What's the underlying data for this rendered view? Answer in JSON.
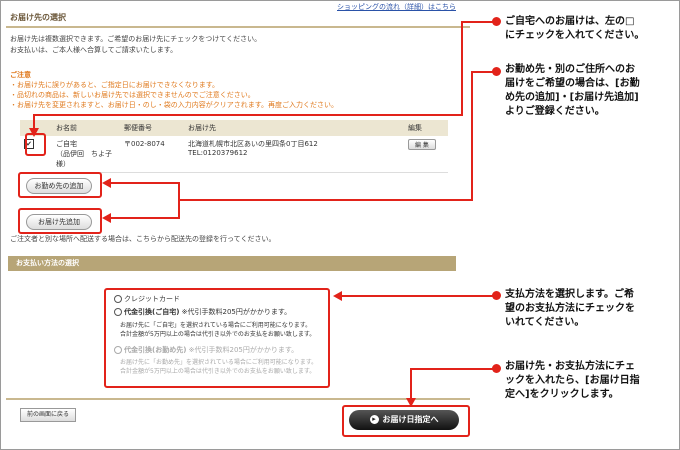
{
  "top_link": "ショッピングの流れ（詳細）はこちら",
  "header": {
    "title": "お届け先の選択"
  },
  "description": [
    "お届け先は複数選択できます。ご希望のお届け先にチェックをつけてください。",
    "お支払いは、ご本人様へ合算してご請求いたします。"
  ],
  "notice": {
    "title": "ご注意",
    "items": [
      "・お届け先に誤りがあると、ご指定日にお届けできなくなります。",
      "・品切れの商品は、新しいお届け先では選択できませんのでご注意ください。",
      "・お届け先を変更されますと、お届け日・のし・袋の入力内容がクリアされます。再度ご入力ください。"
    ]
  },
  "table": {
    "headers": [
      "お名前",
      "郵便番号",
      "お届け先",
      "編集"
    ],
    "rows": [
      {
        "checked": "✔",
        "name": "ご自宅\n（品伊回　ちよ子様）",
        "zip": "〒002-8074",
        "address": "北海道札幌市北区あいの里四条0丁目612",
        "tel": "TEL:0120379612",
        "edit": "編 集"
      }
    ]
  },
  "buttons": {
    "add_work": "お勤め先の追加",
    "add_address": "お届け先追加",
    "back": "前の画面に戻る",
    "next": "お届け日指定へ",
    "edit": "編 集"
  },
  "other_address_note": "ご注文者と別な場所へ配送する場合は、こちらから配送先の登録を行ってください。",
  "payment": {
    "section_title": "お支払い方法の選択",
    "options": [
      {
        "label": "クレジットカード",
        "note": "",
        "disabled": false
      },
      {
        "label": "代金引換(ご自宅)",
        "note": "※代引手数料205円がかかります。",
        "disabled": false
      },
      {
        "label": "代金引換(お勤め先)",
        "note": "※代引手数料205円がかかります。",
        "disabled": true
      }
    ],
    "sub_notes_home": [
      "お届け先に「ご自宅」を選択されている場合にご利用可能になります。",
      "合計金額が5万円以上の場合は代引き以外でのお支払をお願い致します。"
    ],
    "sub_notes_work": [
      "お届け先に「お勤め先」を選択されている場合にご利用可能になります。",
      "合計金額が5万円以上の場合は代引き以外でのお支払をお願い致します。"
    ]
  },
  "annotations": {
    "a1": [
      "ご自宅へのお届けは、左の□",
      "にチェックを入れてください。"
    ],
    "a2": [
      "お勤め先・別のご住所へのお",
      "届けをご希望の場合は、[お勤",
      "め先の追加]・[お届け先追加]",
      "よりご登録ください。"
    ],
    "a3": [
      "支払方法を選択します。ご希",
      "望のお支払方法にチェックを",
      "いれてください。"
    ],
    "a4": [
      "お届け先・お支払方法にチェ",
      "ックを入れたら、[お届け日指",
      "定へ]をクリックします。"
    ]
  },
  "colors": {
    "accent_red": "#e2231a",
    "notice_orange": "#e07a1e",
    "section_bar": "#b7a577"
  }
}
